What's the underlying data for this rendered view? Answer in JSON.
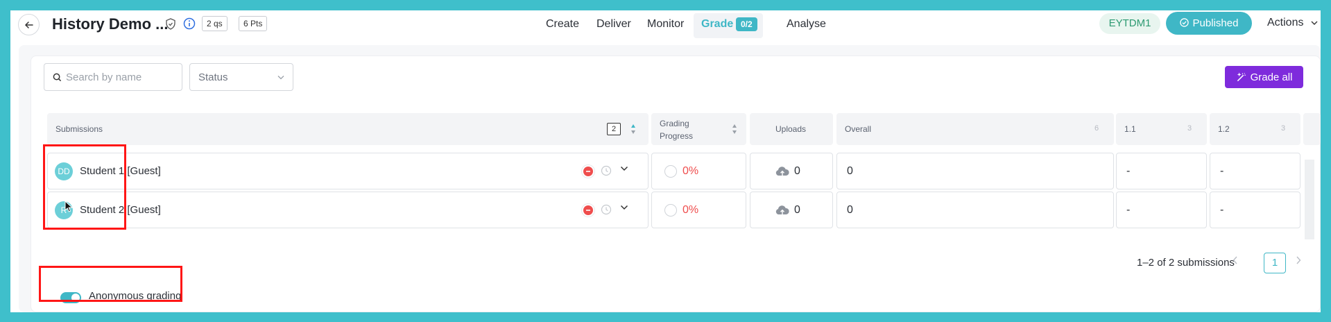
{
  "header": {
    "title": "History Demo ...",
    "questions_chip": "2 qs",
    "points_chip": "6 Pts",
    "nav": [
      "Create",
      "Deliver",
      "Monitor",
      "Grade",
      "Analyse"
    ],
    "grade_badge": "0/2",
    "code": "EYTDM1",
    "published_label": "Published",
    "actions_label": "Actions"
  },
  "toolbar": {
    "search_placeholder": "Search by name",
    "status_placeholder": "Status",
    "grade_all_label": "Grade all"
  },
  "table": {
    "headers": {
      "submissions": "Submissions",
      "submissions_count": "2",
      "grading_progress": "Grading Progress",
      "uploads": "Uploads",
      "overall": "Overall",
      "overall_points": "6",
      "q1": "1.1",
      "q1_points": "3",
      "q2": "1.2",
      "q2_points": "3"
    },
    "rows": [
      {
        "initials": "DD",
        "name": "Student 1 [Guest]",
        "progress": "0%",
        "uploads": "0",
        "overall": "0",
        "q1": "-",
        "q2": "-"
      },
      {
        "initials": "R",
        "name": "Student 2 [Guest]",
        "progress": "0%",
        "uploads": "0",
        "overall": "0",
        "q1": "-",
        "q2": "-"
      }
    ]
  },
  "pagination": {
    "summary": "1–2 of 2 submissions",
    "current_page": "1"
  },
  "footer": {
    "anonymous_label": "Anonymous grading",
    "anonymous_on": true
  },
  "colors": {
    "accent": "#3fb7c6",
    "primary_purple": "#7e2bdc",
    "error_red": "#ef4d4d",
    "highlight_box": "#ff1616"
  }
}
